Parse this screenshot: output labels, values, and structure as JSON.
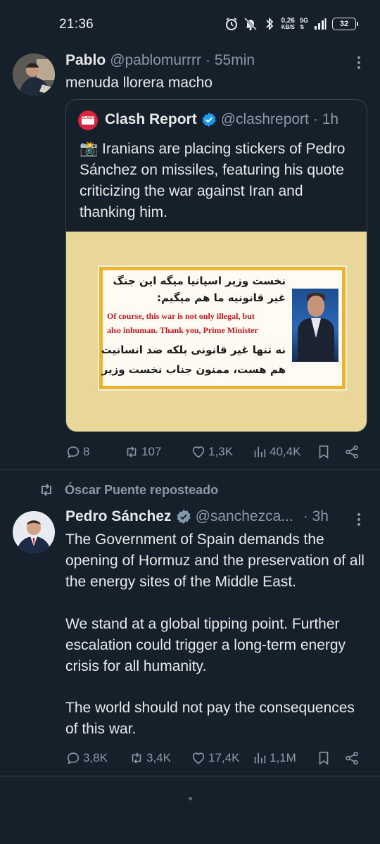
{
  "status_bar": {
    "time": "21:36",
    "speed_value": "0,26",
    "speed_unit": "KB/S",
    "network": "5G",
    "battery": "32"
  },
  "tweet1": {
    "author_name": "Pablo",
    "author_handle": "@pablomurrrr",
    "time": "· 55min",
    "text": "menuda llorera macho",
    "quote": {
      "author_name": "Clash Report",
      "author_handle": "@clashreport",
      "time": "· 1h",
      "logo_text": "CLASH",
      "text": "📸 Iranians are placing stickers of Pedro Sánchez on missiles, featuring his quote criticizing the war against Iran and thanking him.",
      "image": {
        "fa_line1": "نخست وزیر اسپانیا میگه این جنگ",
        "fa_line2": "غیر قانونیه ما هم میگیم:",
        "en_line1": "Of course, this war is not only illegal, but",
        "en_line2": "also inhuman. Thank you, Prime Minister",
        "fa_line3": "نه تنها غیر قانونی بلکه ضد انسانیت",
        "fa_line4": "هم هست، ممنون جناب نخست وزیر"
      }
    },
    "actions": {
      "replies": "8",
      "reposts": "107",
      "likes": "1,3K",
      "views": "40,4K"
    }
  },
  "repost_line": {
    "label": "Óscar Puente reposteado"
  },
  "tweet2": {
    "author_name": "Pedro Sánchez",
    "author_handle": "@sanchezca...",
    "time": "· 3h",
    "paragraph1": "The Government of Spain demands the opening of Hormuz and the preservation of all the energy sites of the Middle East.",
    "paragraph2": "We stand at a global tipping point. Further escalation could trigger a long-term energy crisis for all humanity.",
    "paragraph3": "The world should not pay the consequences of this war.",
    "actions": {
      "replies": "3,8K",
      "reposts": "3,4K",
      "likes": "17,4K",
      "views": "1,1M"
    }
  },
  "colors": {
    "background": "#15202b",
    "text": "#e7e9ea",
    "secondary": "#8b98a5",
    "verified": "#1d9bf0",
    "border": "#38444d"
  }
}
